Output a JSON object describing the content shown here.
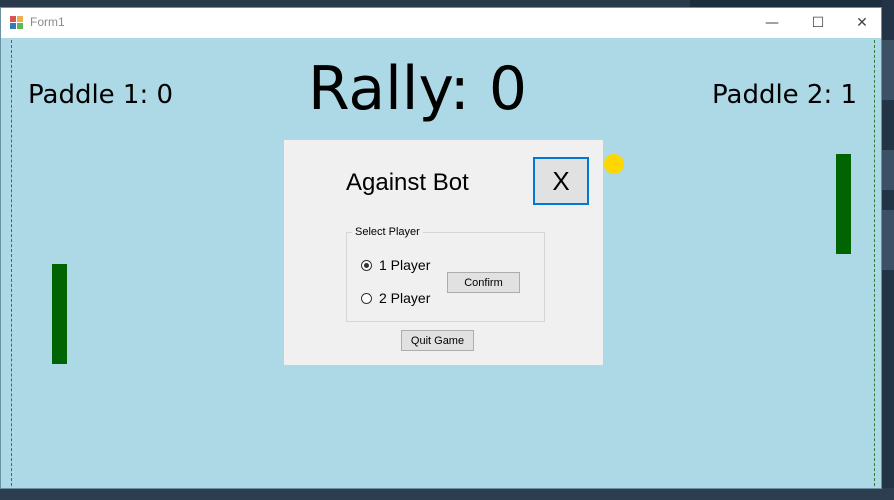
{
  "window": {
    "title": "Form1",
    "controls": {
      "minimize": "—",
      "maximize": "☐",
      "close": "✕"
    }
  },
  "scoreboard": {
    "paddle1": "Paddle 1: 0",
    "paddle2": "Paddle 2: 1",
    "rally": "Rally: 0"
  },
  "menu": {
    "title": "Against Bot",
    "close_label": "X",
    "group_label": "Select Player",
    "options": [
      {
        "label": "1 Player",
        "checked": true
      },
      {
        "label": "2 Player",
        "checked": false
      }
    ],
    "confirm_label": "Confirm",
    "quit_label": "Quit Game"
  },
  "colors": {
    "court": "#add8e6",
    "paddle": "#006400",
    "ball": "#ffd700",
    "focus_border": "#0078d7"
  }
}
